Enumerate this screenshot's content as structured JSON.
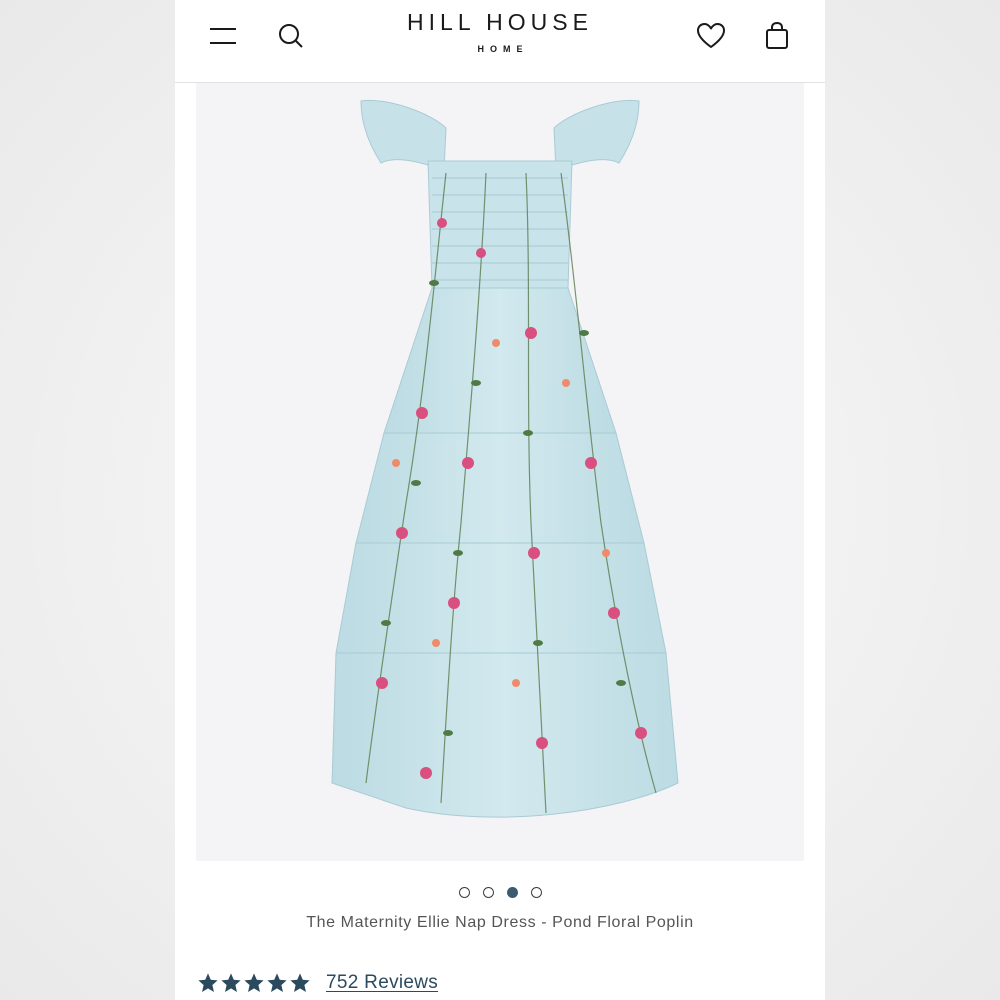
{
  "header": {
    "brand_name": "HILL HOUSE",
    "brand_sub": "HOME",
    "icons": [
      "menu-icon",
      "search-icon",
      "heart-icon",
      "bag-icon"
    ]
  },
  "product": {
    "image_description_icon": "dress-image",
    "gallery_count": 4,
    "gallery_active_index": 2,
    "title": "The Maternity Ellie Nap Dress - Pond Floral Poplin",
    "rating": 5,
    "reviews_label": "752 Reviews"
  },
  "colors": {
    "accent": "#2b4a5e",
    "star": "#2b4a5e",
    "dress": "#cfe6ec"
  }
}
